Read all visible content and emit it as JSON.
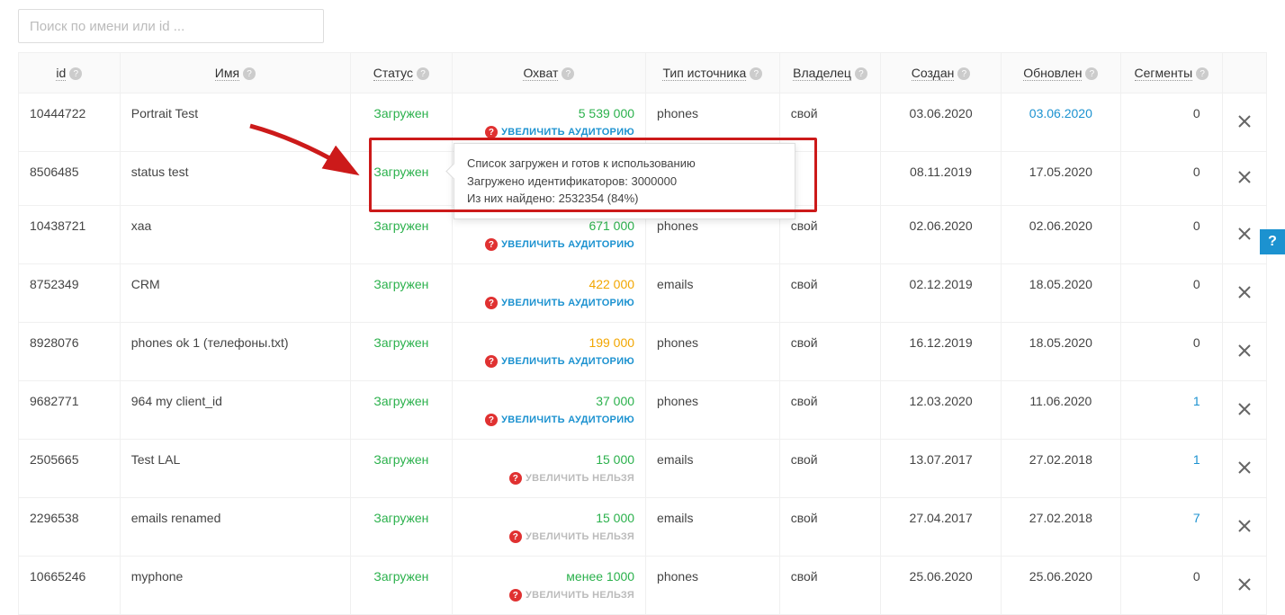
{
  "search": {
    "placeholder": "Поиск по имени или id ..."
  },
  "columns": {
    "id": "id",
    "name": "Имя",
    "status": "Статус",
    "reach": "Охват",
    "source": "Тип источника",
    "owner": "Владелец",
    "created": "Создан",
    "updated": "Обновлен",
    "segments": "Сегменты"
  },
  "actions": {
    "increase": "УВЕЛИЧИТЬ АУДИТОРИЮ",
    "cannot": "УВЕЛИЧИТЬ НЕЛЬЗЯ"
  },
  "tooltip": {
    "line1": "Список загружен и готов к использованию",
    "line2": "Загружено идентификаторов: 3000000",
    "line3": "Из них найдено: 2532354 (84%)"
  },
  "help": "?",
  "rows": [
    {
      "id": "10444722",
      "name": "Portrait Test",
      "status": "Загружен",
      "reach": "5 539 000",
      "reach_color": "green",
      "action": "increase",
      "source": "phones",
      "owner": "свой",
      "created": "03.06.2020",
      "updated": "03.06.2020",
      "updated_blue": true,
      "segments": "0"
    },
    {
      "id": "8506485",
      "name": "status test",
      "status": "Загружен",
      "reach": "",
      "source": "",
      "owner": "",
      "created": "08.11.2019",
      "updated": "17.05.2020",
      "segments": "0"
    },
    {
      "id": "10438721",
      "name": "xaa",
      "status": "Загружен",
      "reach": "671 000",
      "reach_color": "green",
      "action": "increase",
      "source": "phones",
      "owner": "свой",
      "created": "02.06.2020",
      "updated": "02.06.2020",
      "segments": "0"
    },
    {
      "id": "8752349",
      "name": "CRM",
      "status": "Загружен",
      "reach": "422 000",
      "reach_color": "orange",
      "action": "increase",
      "source": "emails",
      "owner": "свой",
      "created": "02.12.2019",
      "updated": "18.05.2020",
      "segments": "0"
    },
    {
      "id": "8928076",
      "name": "phones ok 1 (телефоны.txt)",
      "status": "Загружен",
      "reach": "199 000",
      "reach_color": "orange",
      "action": "increase",
      "source": "phones",
      "owner": "свой",
      "created": "16.12.2019",
      "updated": "18.05.2020",
      "segments": "0"
    },
    {
      "id": "9682771",
      "name": "964 my client_id",
      "status": "Загружен",
      "reach": "37 000",
      "reach_color": "green",
      "action": "increase",
      "source": "phones",
      "owner": "свой",
      "created": "12.03.2020",
      "updated": "11.06.2020",
      "segments": "1",
      "seg_blue": true
    },
    {
      "id": "2505665",
      "name": "Test LAL",
      "status": "Загружен",
      "reach": "15 000",
      "reach_color": "green",
      "action": "cannot",
      "source": "emails",
      "owner": "свой",
      "created": "13.07.2017",
      "updated": "27.02.2018",
      "segments": "1",
      "seg_blue": true
    },
    {
      "id": "2296538",
      "name": "emails renamed",
      "status": "Загружен",
      "reach": "15 000",
      "reach_color": "green",
      "action": "cannot",
      "source": "emails",
      "owner": "свой",
      "created": "27.04.2017",
      "updated": "27.02.2018",
      "segments": "7",
      "seg_blue": true
    },
    {
      "id": "10665246",
      "name": "myphone",
      "status": "Загружен",
      "reach": "менее 1000",
      "reach_color": "green",
      "action": "cannot",
      "source": "phones",
      "owner": "свой",
      "created": "25.06.2020",
      "updated": "25.06.2020",
      "segments": "0"
    }
  ]
}
